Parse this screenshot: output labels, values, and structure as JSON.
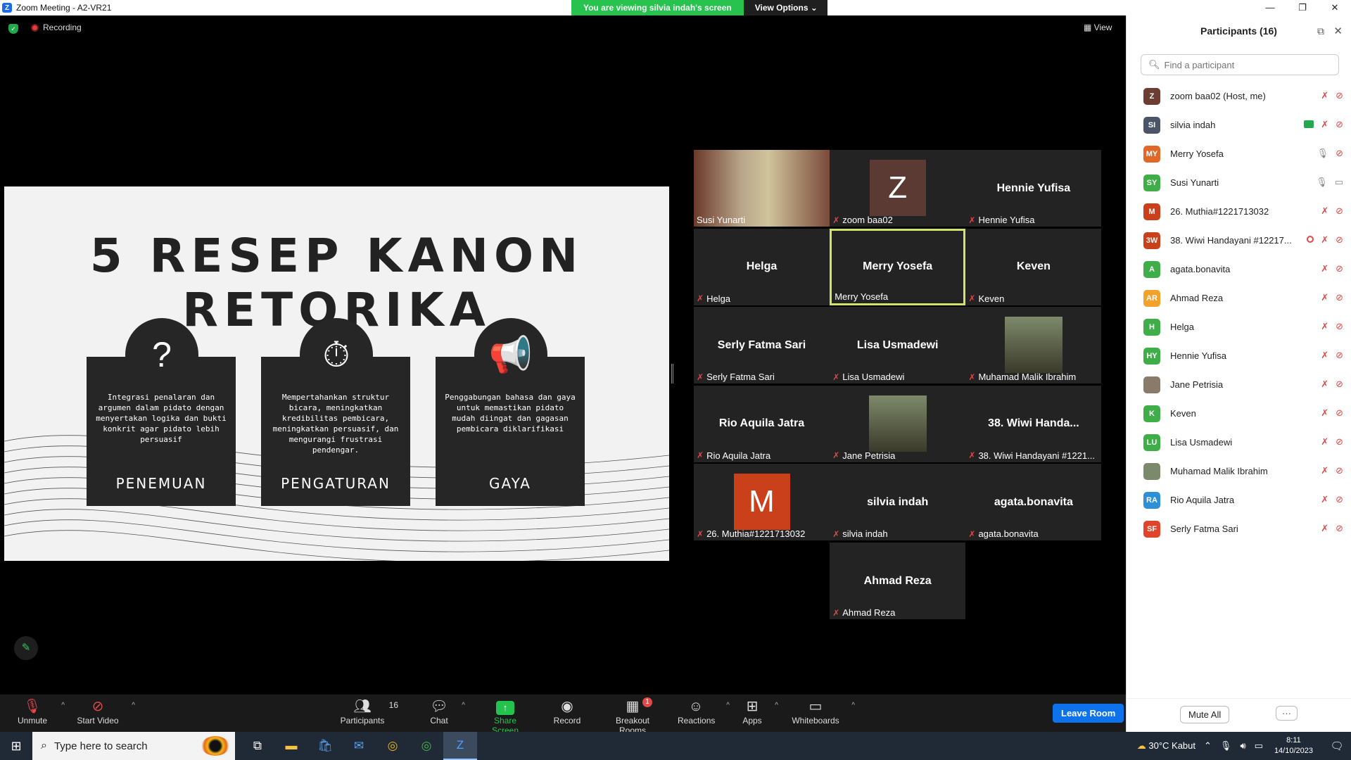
{
  "window": {
    "title": "Zoom Meeting - A2-VR21",
    "viewing_msg": "You are viewing silvia indah's screen",
    "view_options": "View Options"
  },
  "stage": {
    "recording": "Recording",
    "view": "View"
  },
  "slide": {
    "title": "5 RESEP KANON RETORIKA",
    "cards": [
      {
        "icon": "question-head-icon",
        "desc": "Integrasi penalaran dan argumen dalam pidato dengan menyertakan logika dan bukti konkrit agar pidato lebih persuasif",
        "name": "PENEMUAN"
      },
      {
        "icon": "stopwatch-check-icon",
        "desc": "Mempertahankan struktur bicara, meningkatkan kredibilitas pembicara, meningkatkan persuasif, dan mengurangi frustrasi pendengar.",
        "name": "PENGATURAN"
      },
      {
        "icon": "megaphone-icon",
        "desc": "Penggabungan bahasa dan gaya untuk memastikan pidato mudah diingat dan gagasan pembicara diklarifikasi",
        "name": "GAYA"
      }
    ]
  },
  "gallery": {
    "tiles": [
      {
        "label": "Susi Yunarti",
        "center": "",
        "avatar": "",
        "color": "",
        "photo": true,
        "muted": false
      },
      {
        "label": "zoom baa02",
        "center": "",
        "avatar": "Z",
        "color": "#5b3a33",
        "photo": false,
        "muted": true
      },
      {
        "label": "Hennie Yufisa",
        "center": "Hennie Yufisa",
        "avatar": "",
        "color": "",
        "photo": false,
        "muted": true
      },
      {
        "label": "Helga",
        "center": "Helga",
        "avatar": "",
        "color": "",
        "photo": false,
        "muted": true
      },
      {
        "label": "Merry Yosefa",
        "center": "Merry Yosefa",
        "avatar": "",
        "color": "",
        "photo": false,
        "muted": false,
        "active": true
      },
      {
        "label": "Keven",
        "center": "Keven",
        "avatar": "",
        "color": "",
        "photo": false,
        "muted": true
      },
      {
        "label": "Serly Fatma Sari",
        "center": "Serly Fatma Sari",
        "avatar": "",
        "color": "",
        "photo": false,
        "muted": true
      },
      {
        "label": "Lisa Usmadewi",
        "center": "Lisa Usmadewi",
        "avatar": "",
        "color": "",
        "photo": false,
        "muted": true
      },
      {
        "label": "Muhamad Malik Ibrahim",
        "center": "",
        "avatar": "",
        "color": "",
        "photo": true,
        "muted": true
      },
      {
        "label": "Rio Aquila Jatra",
        "center": "Rio Aquila Jatra",
        "avatar": "",
        "color": "",
        "photo": false,
        "muted": true
      },
      {
        "label": "Jane Petrisia",
        "center": "",
        "avatar": "",
        "color": "",
        "photo": true,
        "muted": true
      },
      {
        "label": "38. Wiwi Handayani #1221...",
        "center": "38. Wiwi Handa...",
        "avatar": "",
        "color": "",
        "photo": false,
        "muted": true
      },
      {
        "label": "26. Muthia#1221713032",
        "center": "",
        "avatar": "M",
        "color": "#c9401a",
        "photo": false,
        "muted": true
      },
      {
        "label": "silvia indah",
        "center": "silvia indah",
        "avatar": "",
        "color": "",
        "photo": false,
        "muted": true
      },
      {
        "label": "agata.bonavita",
        "center": "agata.bonavita",
        "avatar": "",
        "color": "",
        "photo": false,
        "muted": true
      },
      {
        "label": "Ahmad Reza",
        "center": "Ahmad Reza",
        "avatar": "",
        "color": "",
        "photo": false,
        "muted": true
      }
    ]
  },
  "participants": {
    "title": "Participants (16)",
    "search_placeholder": "Find a participant",
    "list": [
      {
        "initials": "Z",
        "color": "#6b3d33",
        "name": "zoom baa02 (Host, me)",
        "mic": "muted",
        "share": false,
        "rec": false
      },
      {
        "initials": "SI",
        "color": "#4a5568",
        "name": "silvia indah",
        "mic": "muted",
        "share": true,
        "rec": false
      },
      {
        "initials": "MY",
        "color": "#e0692a",
        "name": "Merry Yosefa",
        "mic": "on",
        "share": false,
        "rec": false
      },
      {
        "initials": "SY",
        "color": "#3fae49",
        "name": "Susi Yunarti",
        "mic": "on",
        "share": false,
        "rec": false
      },
      {
        "initials": "M",
        "color": "#c9401a",
        "name": "26. Muthia#1221713032",
        "mic": "muted",
        "share": false,
        "rec": false
      },
      {
        "initials": "3W",
        "color": "#c9401a",
        "name": "38. Wiwi Handayani #12217...",
        "mic": "muted",
        "share": false,
        "rec": true
      },
      {
        "initials": "A",
        "color": "#3fae49",
        "name": "agata.bonavita",
        "mic": "muted",
        "share": false,
        "rec": false
      },
      {
        "initials": "AR",
        "color": "#f2a12b",
        "name": "Ahmad Reza",
        "mic": "muted",
        "share": false,
        "rec": false
      },
      {
        "initials": "H",
        "color": "#3fae49",
        "name": "Helga",
        "mic": "muted",
        "share": false,
        "rec": false
      },
      {
        "initials": "HY",
        "color": "#3fae49",
        "name": "Hennie Yufisa",
        "mic": "muted",
        "share": false,
        "rec": false
      },
      {
        "initials": "",
        "color": "#8a7a6a",
        "name": "Jane Petrisia",
        "mic": "muted",
        "share": false,
        "rec": false
      },
      {
        "initials": "K",
        "color": "#3fae49",
        "name": "Keven",
        "mic": "muted",
        "share": false,
        "rec": false
      },
      {
        "initials": "LU",
        "color": "#3fae49",
        "name": "Lisa Usmadewi",
        "mic": "muted",
        "share": false,
        "rec": false
      },
      {
        "initials": "",
        "color": "#7a8a6a",
        "name": "Muhamad Malik Ibrahim",
        "mic": "muted",
        "share": false,
        "rec": false
      },
      {
        "initials": "RA",
        "color": "#2d8fd5",
        "name": "Rio Aquila Jatra",
        "mic": "muted",
        "share": false,
        "rec": false
      },
      {
        "initials": "SF",
        "color": "#e0442a",
        "name": "Serly Fatma Sari",
        "mic": "muted",
        "share": false,
        "rec": false
      }
    ],
    "mute_all": "Mute All",
    "more": "···"
  },
  "toolbar": {
    "unmute": "Unmute",
    "start_video": "Start Video",
    "participants": "Participants",
    "participants_count": "16",
    "chat": "Chat",
    "share_screen": "Share Screen",
    "record": "Record",
    "breakout": "Breakout Rooms",
    "breakout_badge": "1",
    "reactions": "Reactions",
    "apps": "Apps",
    "whiteboards": "Whiteboards",
    "leave": "Leave Room"
  },
  "taskbar": {
    "search_placeholder": "Type here to search",
    "weather": "30°C  Kabut",
    "time": "8:11",
    "date": "14/10/2023"
  }
}
